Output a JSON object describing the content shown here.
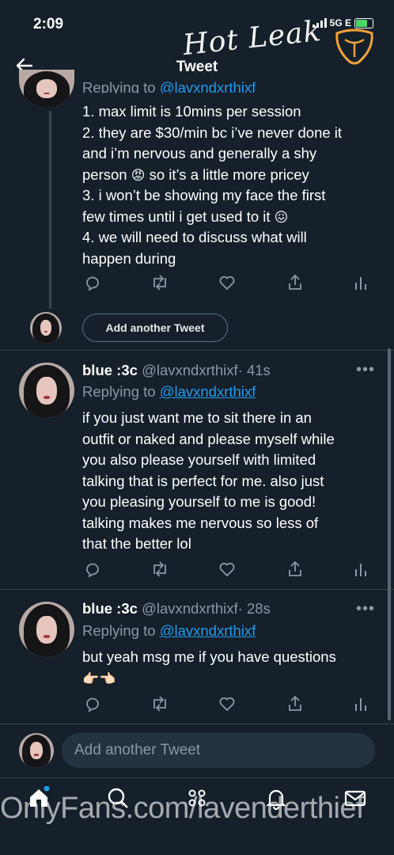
{
  "status": {
    "time": "2:09",
    "network": "5G E"
  },
  "watermark": {
    "top": "Hot Leak",
    "bottom": "OnlyFans.com/lavenderthief"
  },
  "header": {
    "back_icon": "arrow-left-icon",
    "title": "Tweet"
  },
  "tweet1": {
    "replying_prefix": "Replying to ",
    "replying_handle": "@lavxndxrthixf",
    "lines": [
      "1. max limit is 10mins per session",
      "2. they are $30/min bc i’ve never done it",
      "and i’m nervous and generally a shy",
      "person",
      "so it’s a little more pricey",
      "3. i won’t be showing my face the first",
      "few times until i get used to it",
      "4. we will need to discuss what will",
      "happen during"
    ],
    "emoji_angry": "😡",
    "emoji_confounded": "😖"
  },
  "add_another_button": "Add another Tweet",
  "tweet2": {
    "name": "blue :3c",
    "handle": "@lavxndxrthixf",
    "time": "· 41s",
    "replying_prefix": "Replying to ",
    "replying_handle": "@lavxndxrthixf",
    "lines": [
      "if you just want me to sit there in an",
      "outfit or naked and please myself while",
      "you also please yourself with limited",
      "talking that is perfect for me. also just",
      "you pleasing yourself to me is good!",
      "talking makes me nervous so less of",
      "that the better lol"
    ],
    "more": "•••"
  },
  "tweet3": {
    "name": "blue :3c",
    "handle": "@lavxndxrthixf",
    "time": "· 28s",
    "replying_prefix": "Replying to ",
    "replying_handle": "@lavxndxrthixf",
    "lines": [
      "but yeah msg me if you have questions"
    ],
    "emoji": "👉🏻👈🏻",
    "more": "•••"
  },
  "compose": {
    "placeholder": "Add another Tweet"
  },
  "tabs": [
    "home-icon",
    "search-icon",
    "spaces-icon",
    "notifications-icon",
    "messages-icon"
  ],
  "colors": {
    "background": "#15202b",
    "accent": "#1d9bf0",
    "muted": "#8b98a5",
    "divider": "#38444d"
  }
}
